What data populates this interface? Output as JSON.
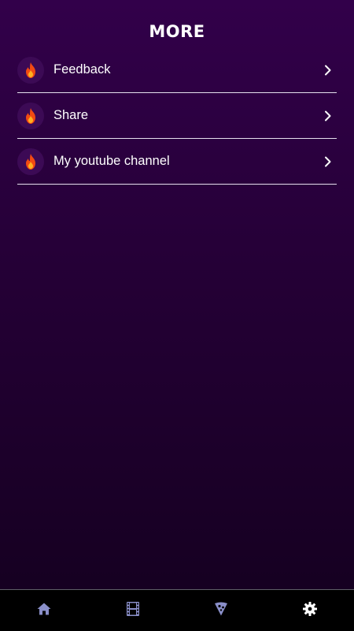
{
  "header": {
    "title": "MORE"
  },
  "menu": {
    "items": [
      {
        "label": "Feedback",
        "icon": "fire-icon"
      },
      {
        "label": "Share",
        "icon": "fire-icon"
      },
      {
        "label": "My youtube channel",
        "icon": "fire-icon"
      }
    ]
  },
  "tabbar": {
    "tabs": [
      {
        "icon": "home-icon",
        "active": false
      },
      {
        "icon": "film-icon",
        "active": false
      },
      {
        "icon": "pizza-icon",
        "active": false
      },
      {
        "icon": "gear-icon",
        "active": true
      }
    ]
  },
  "colors": {
    "background_top": "#32004a",
    "background_bottom": "#14001f",
    "tab_inactive": "#8a8fc9",
    "tab_active": "#ffffff",
    "flame_outer": "#f24a12",
    "flame_inner": "#ffb020"
  }
}
